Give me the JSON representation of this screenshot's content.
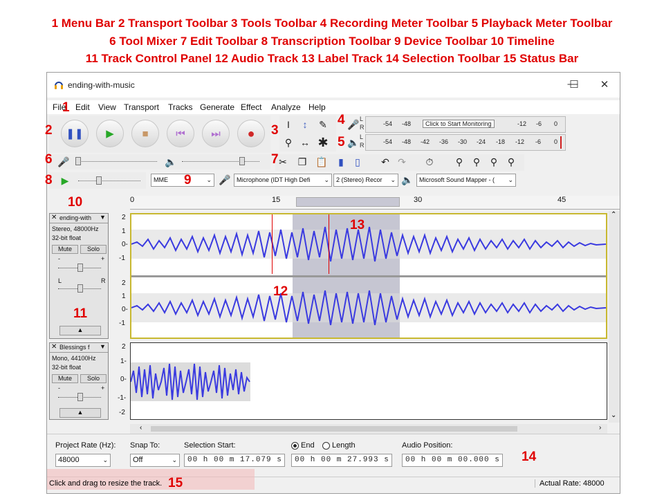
{
  "legend": {
    "line1": "1 Menu Bar  2 Transport Toolbar  3 Tools Toolbar  4 Recording Meter Toolbar  5 Playback Meter Toolbar",
    "line2": "6 Tool Mixer 7 Edit Toolbar   8 Transcription Toolbar   9 Device Toolbar  10 Timeline",
    "line3": "11 Track Control Panel   12 Audio Track   13 Label Track   14 Selection Toolbar   15 Status Bar"
  },
  "callouts": [
    "1",
    "2",
    "3",
    "4",
    "5",
    "6",
    "7",
    "8",
    "9",
    "10",
    "11",
    "12",
    "13",
    "14",
    "15"
  ],
  "window": {
    "title": "ending-with-music",
    "minimize": "—",
    "maximize": "☐",
    "close": "✕"
  },
  "menu": [
    "File",
    "Edit",
    "View",
    "Transport",
    "Tracks",
    "Generate",
    "Effect",
    "Analyze",
    "Help"
  ],
  "meters": {
    "record_ticks": [
      "-54",
      "-48",
      "-12",
      "-6",
      "0"
    ],
    "record_hint": "Click to Start Monitoring",
    "record_channels": [
      "L",
      "R"
    ],
    "play_ticks": [
      "-54",
      "-48",
      "-42",
      "-36",
      "-30",
      "-24",
      "-18",
      "-12",
      "-6",
      "0"
    ],
    "play_channels": [
      "L",
      "R"
    ]
  },
  "devices": {
    "host": "MME",
    "input": "Microphone (IDT High Defi",
    "channels": "2 (Stereo) Recor",
    "output": "Microsoft Sound Mapper - ("
  },
  "timeline": {
    "ticks": [
      "0",
      "15",
      "30",
      "45"
    ]
  },
  "tracks": [
    {
      "name": "ending-with",
      "info1": "Stereo, 48000Hz",
      "info2": "32-bit float",
      "mute": "Mute",
      "solo": "Solo",
      "scale_top": [
        "2",
        "1",
        "0-",
        "-1"
      ],
      "scale_bottom": [
        "2",
        "1",
        "0-",
        "-1"
      ]
    },
    {
      "name": "Blessings f",
      "info1": "Mono, 44100Hz",
      "info2": "32-bit float",
      "mute": "Mute",
      "solo": "Solo",
      "scale": [
        "2",
        "1-",
        "0-",
        "-1-",
        "-2"
      ]
    }
  ],
  "gain_labels": {
    "minus": "-",
    "plus": "+",
    "left": "L",
    "right": "R"
  },
  "selection": {
    "project_rate_label": "Project Rate (Hz):",
    "project_rate": "48000",
    "snap_label": "Snap To:",
    "snap": "Off",
    "start_label": "Selection Start:",
    "start": "00 h 00 m 17.079 s",
    "end_label": "End",
    "length_label": "Length",
    "end": "00 h 00 m 27.993 s",
    "audio_pos_label": "Audio Position:",
    "audio_pos": "00 h 00 m 00.000 s"
  },
  "status": {
    "message": "Click and drag to resize the track.",
    "rate": "Actual Rate: 48000"
  },
  "colors": {
    "accent": "#e00000",
    "wave": "#3a3ae0",
    "selection": "#b8b8c8"
  }
}
